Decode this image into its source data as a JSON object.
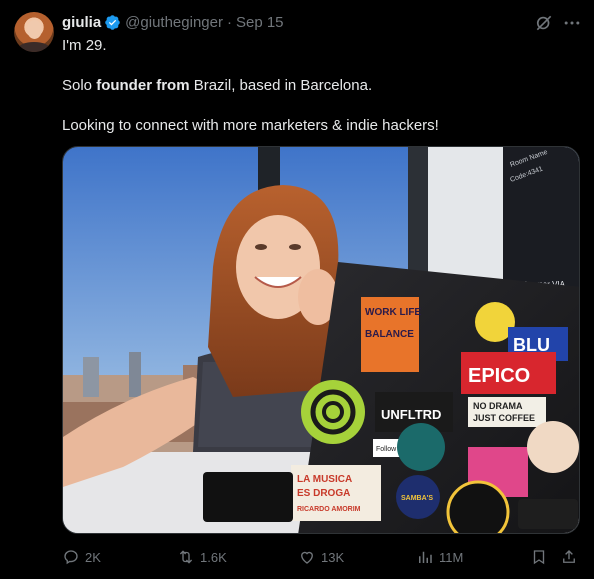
{
  "author": {
    "name": "giulia",
    "handle": "@giutheginger",
    "separator": "·",
    "date": "Sep 15"
  },
  "body": {
    "line1": "I'm 29.",
    "line2_pre": "Solo ",
    "line2_bold": "founder from",
    "line2_post": " Brazil, based in Barcelona.",
    "line3": "Looking to connect with more marketers & indie hackers!"
  },
  "media": {
    "sign_room": "Room Name",
    "sign_code": "Code:4341",
    "sign_brand": "kramer VIA",
    "stickers": {
      "work": "WORK LIFE",
      "balance": "BALANCE",
      "unfltrd": "UNFLTRD",
      "epico": "EPICO",
      "nodrama1": "NO DRAMA",
      "nodrama2": "JUST COFFEE",
      "musica1": "LA MUSICA",
      "musica2": "ES DROGA",
      "ricardo": "RICARDO AMORIM",
      "blu": "BLU",
      "follow": "Follow the Data",
      "sambas": "SAMBA'S"
    }
  },
  "stats": {
    "replies": "2K",
    "reposts": "1.6K",
    "likes": "13K",
    "views": "11M"
  },
  "icons": {
    "verified": "verified-badge-icon",
    "grok": "grok-icon",
    "more": "more-icon",
    "reply": "reply-icon",
    "repost": "repost-icon",
    "like": "like-icon",
    "views": "views-icon",
    "bookmark": "bookmark-icon",
    "share": "share-icon"
  },
  "colors": {
    "background": "#000000",
    "text": "#e7e9ea",
    "muted": "#71767b",
    "verified": "#1d9bf0"
  }
}
